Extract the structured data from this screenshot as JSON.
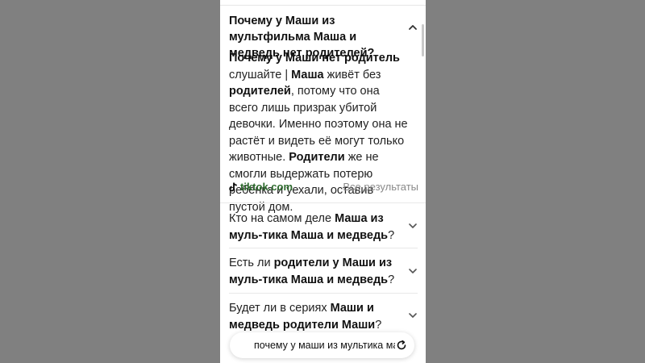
{
  "open_question": {
    "title": "Почему у Маши из мультфильма Маша и медведь нет родителей?",
    "answer": [
      {
        "t": "Почему у Маши нет родитель",
        "b": true
      },
      {
        "t": " слушайте | ",
        "b": false
      },
      {
        "t": "Маша",
        "b": true
      },
      {
        "t": " живёт без ",
        "b": false
      },
      {
        "t": "родителей",
        "b": true
      },
      {
        "t": ", потому что она всего лишь призрак убитой девочки. Именно поэтому она не растёт и видеть её могут только животные. ",
        "b": false
      },
      {
        "t": "Родители",
        "b": true
      },
      {
        "t": " же не смогли выдержать потерю ребёнка и уехали, оставив пустой дом.",
        "b": false
      }
    ],
    "source": "tiktok.com",
    "all_results": "Все результаты"
  },
  "questions": [
    {
      "parts": [
        {
          "t": "Кто на самом деле ",
          "b": false
        },
        {
          "t": "Маша из муль-тика Маша и медведь",
          "b": true
        },
        {
          "t": "?",
          "b": false
        }
      ]
    },
    {
      "parts": [
        {
          "t": "Есть ли ",
          "b": false
        },
        {
          "t": "родители у Маши из муль-тика Маша и медведь",
          "b": true
        },
        {
          "t": "?",
          "b": false
        }
      ]
    },
    {
      "parts": [
        {
          "t": "Будет ли в сериях ",
          "b": false
        },
        {
          "t": "Маши и медведь родители Маши",
          "b": true
        },
        {
          "t": "?",
          "b": false
        }
      ]
    }
  ],
  "search": {
    "query": "почему у маши из мультика маша"
  },
  "icons": {
    "chevron_up": "chevron-up-icon",
    "chevron_down": "chevron-down-icon",
    "tiktok": "tiktok-icon",
    "refresh": "refresh-icon"
  }
}
